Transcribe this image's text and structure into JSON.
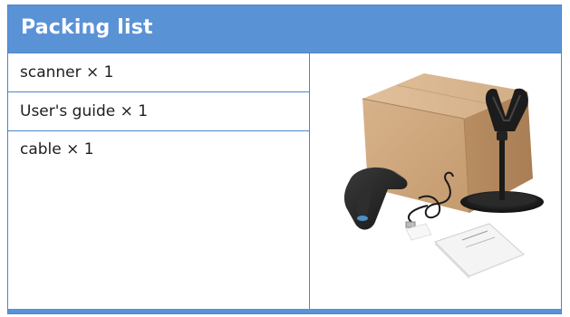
{
  "header": {
    "title": "Packing list"
  },
  "items": [
    {
      "label": "scanner × 1"
    },
    {
      "label": "User's guide × 1"
    },
    {
      "label": "cable × 1"
    }
  ],
  "colors": {
    "header_bg": "#5a92d6",
    "border": "#4a86cc",
    "header_text": "#ffffff",
    "body_text": "#1e1e1e"
  },
  "image": {
    "content": "product-photo-icon"
  }
}
